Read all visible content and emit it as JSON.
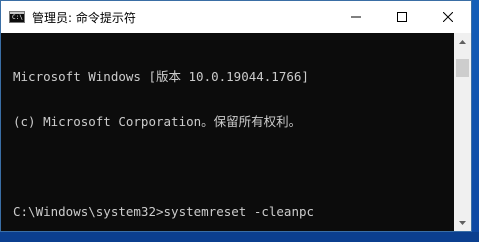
{
  "window": {
    "title": "管理员: 命令提示符",
    "app_icon_glyph": "C:\\"
  },
  "controls": {
    "minimize": "minimize-icon",
    "maximize": "maximize-icon",
    "close": "close-icon"
  },
  "console": {
    "lines": [
      "Microsoft Windows [版本 10.0.19044.1766]",
      "(c) Microsoft Corporation。保留所有权利。",
      "",
      "C:\\Windows\\system32>systemreset -cleanpc"
    ]
  },
  "colors": {
    "console_bg": "#0c0c0c",
    "console_text": "#cccccc",
    "titlebar_bg": "#ffffff"
  }
}
